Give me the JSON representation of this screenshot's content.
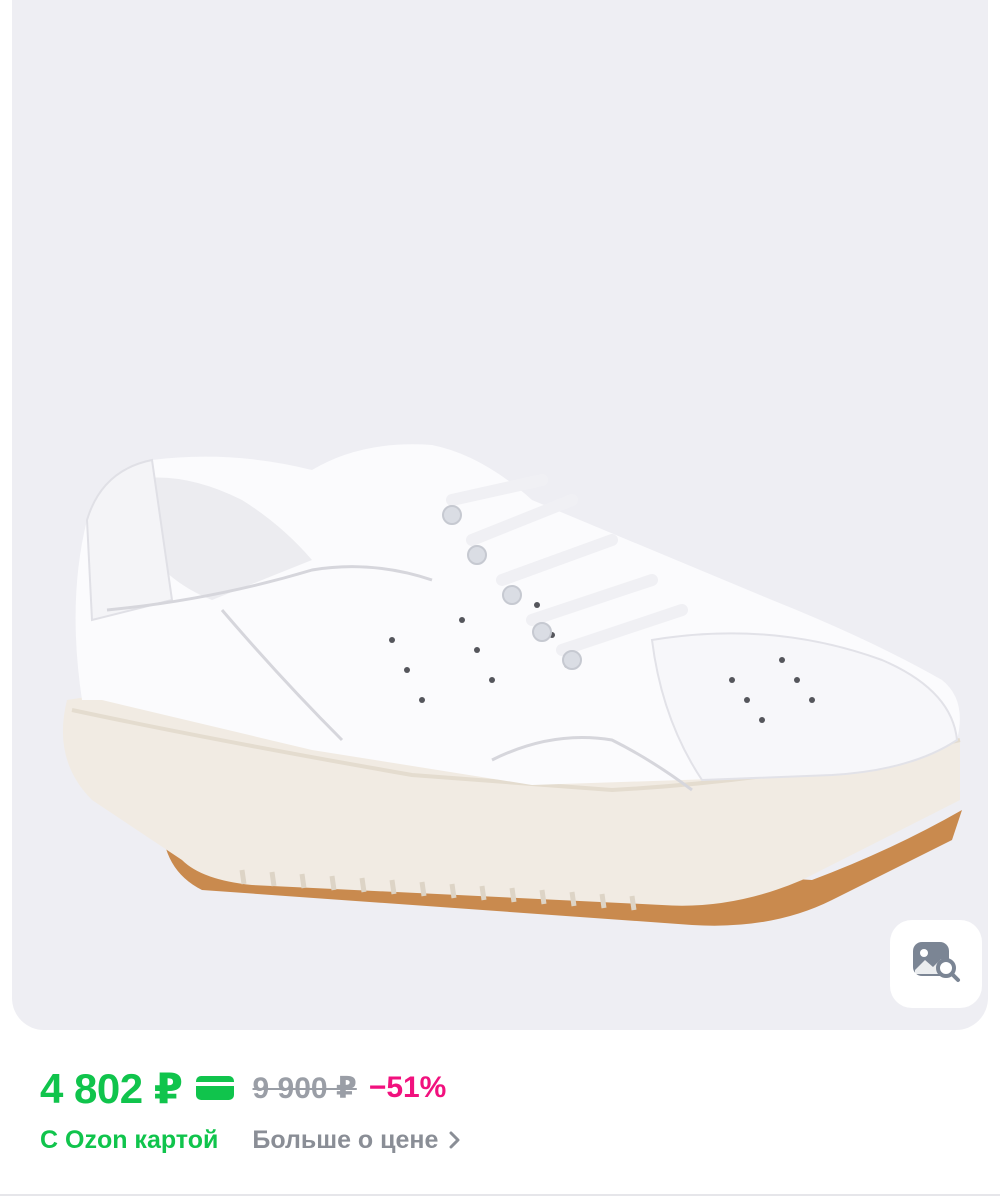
{
  "product": {
    "image_alt": "white-leather-sneaker-photo"
  },
  "price": {
    "current": "4 802 ₽",
    "old": "9 900 ₽",
    "discount": "−51%",
    "card_label": "С Ozon картой",
    "more_label": "Больше о цене"
  },
  "colors": {
    "accent_green": "#10c44c",
    "discount_pink": "#f1117e",
    "muted_grey": "#9a9ea6",
    "card_bg": "#eeeef3"
  },
  "icons": {
    "search_photo": "image-search-icon",
    "card": "card-icon",
    "chevron": "chevron-right-icon"
  }
}
